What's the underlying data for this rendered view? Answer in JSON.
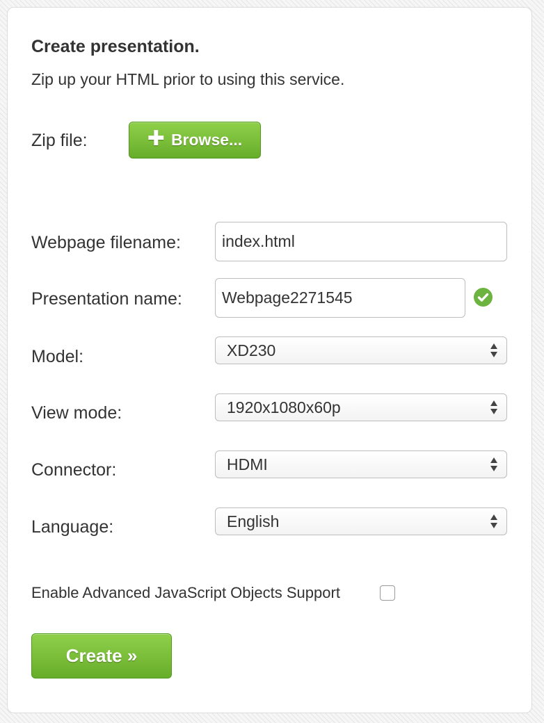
{
  "form": {
    "title": "Create presentation.",
    "subtitle": "Zip up your HTML prior to using this service.",
    "zip_label": "Zip file:",
    "browse_icon": "plus-icon",
    "browse_label": "Browse...",
    "webpage_filename_label": "Webpage filename:",
    "webpage_filename_value": "index.html",
    "presentation_name_label": "Presentation name:",
    "presentation_name_value": "Webpage2271545",
    "presentation_name_status_icon": "check-circle-icon",
    "model_label": "Model:",
    "model_value": "XD230",
    "view_mode_label": "View mode:",
    "view_mode_value": "1920x1080x60p",
    "connector_label": "Connector:",
    "connector_value": "HDMI",
    "language_label": "Language:",
    "language_value": "English",
    "advanced_js_label": "Enable Advanced JavaScript Objects Support",
    "advanced_js_checked": false,
    "create_label": "Create »"
  },
  "colors": {
    "accent_green": "#6cb33f",
    "button_green_top": "#8fd04a",
    "button_green_bottom": "#67ad2a",
    "text": "#333333",
    "field_border": "#bdbdbd"
  }
}
